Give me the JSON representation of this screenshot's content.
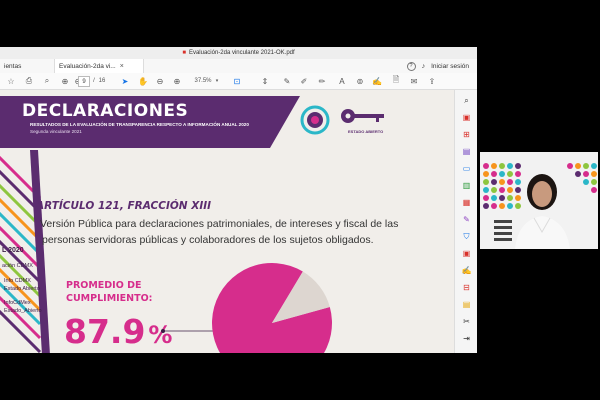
{
  "window": {
    "file_title": "Evaluación-2da vinculante 2021-OK.pdf",
    "tabs": [
      {
        "label": "ientas"
      },
      {
        "label": "Evaluación-2da vi...",
        "close": "×"
      }
    ],
    "signin_label": "Iniciar sesión",
    "help_icon": "?",
    "bell_icon": "bell-icon"
  },
  "toolbar": {
    "page_current": "9",
    "page_sep": "/",
    "page_total": "16",
    "zoom": "37.5%"
  },
  "slide": {
    "banner_title": "DECLARACIONES",
    "banner_sub1": "RESULTADOS DE LA EVALUACIÓN DE TRANSPARENCIA RESPECTO A INFORMACIÓN ANUAL 2020",
    "banner_sub2": "Segunda vinculante 2021",
    "logo_estado": "ESTADO ABIERTO",
    "heading": "ARTÍCULO 121, FRACCIÓN XIII",
    "body_line1": "Versión Pública para declaraciones patrimoniales, de intereses y fiscal de las",
    "body_line2": "personas servidoras públicas y colaboradores de los sujetos obligados.",
    "promedio_label1": "PROMEDIO DE",
    "promedio_label2": "CUMPLIMIENTO:",
    "promedio_value": "87.9",
    "promedio_unit": "%",
    "side_texts": [
      "L 2020",
      "ación CDMX",
      "Info CDMX",
      "Estado Abierto",
      "InfoCdMex",
      "Estado_Abierto"
    ]
  },
  "pie": {
    "value": 87.9,
    "color_main": "#d62d8c",
    "color_rest": "#ddd6d0"
  },
  "colors": {
    "purple": "#5b2c6f",
    "magenta": "#d62d8c",
    "accent_blue": "#1473e6"
  }
}
